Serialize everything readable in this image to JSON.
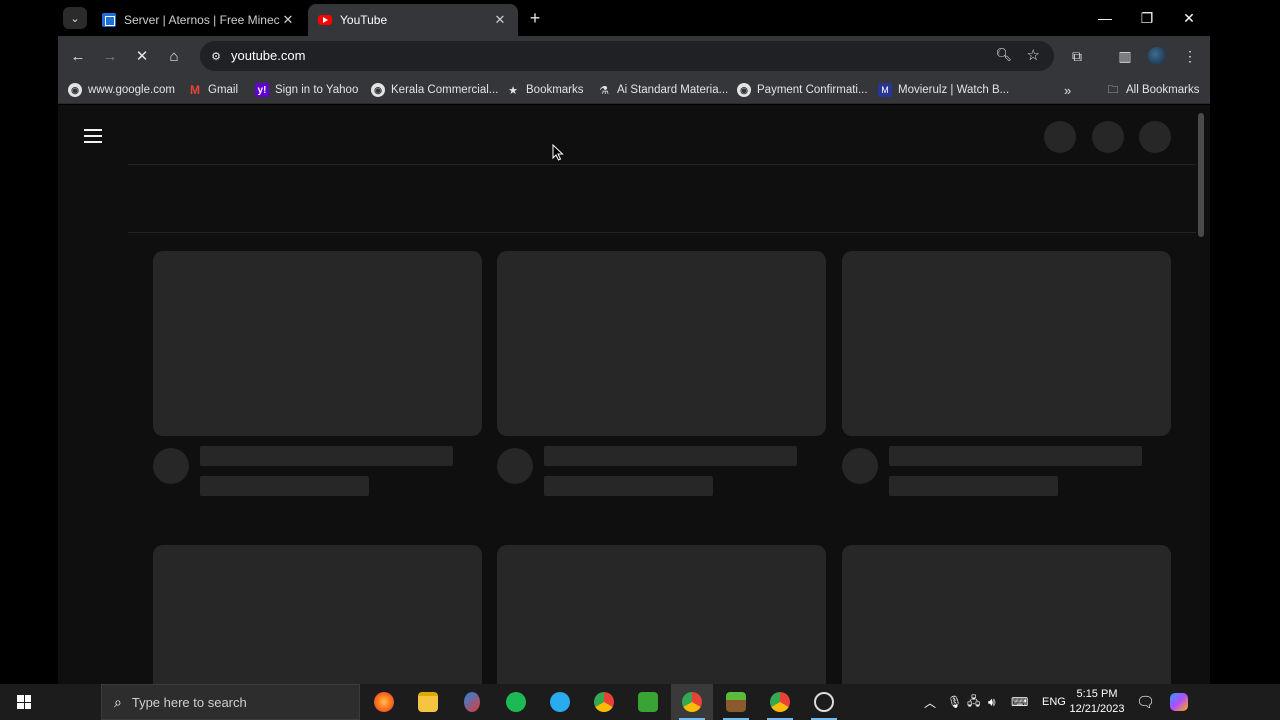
{
  "tabs": [
    {
      "title": "Server | Aternos | Free Minecraft",
      "favicon": "aternos-icon"
    },
    {
      "title": "YouTube",
      "favicon": "youtube-icon"
    }
  ],
  "toolbar": {
    "url": "youtube.com"
  },
  "bookmarks": [
    {
      "label": "www.google.com",
      "icon": "globe-icon"
    },
    {
      "label": "Gmail",
      "icon": "gmail-icon"
    },
    {
      "label": "Sign in to Yahoo",
      "icon": "yahoo-icon"
    },
    {
      "label": "Kerala Commercial...",
      "icon": "globe-icon"
    },
    {
      "label": "Bookmarks",
      "icon": "star-icon"
    },
    {
      "label": "Ai Standard Materia...",
      "icon": "flask-icon"
    },
    {
      "label": "Payment Confirmati...",
      "icon": "globe-icon"
    },
    {
      "label": "Movierulz | Watch B...",
      "icon": "movierulz-icon"
    }
  ],
  "all_bookmarks_label": "All Bookmarks",
  "taskbar": {
    "search_placeholder": "Type here to search",
    "language": "ENG",
    "time": "5:15 PM",
    "date": "12/21/2023",
    "apps": [
      "firefox",
      "file-explorer",
      "snipping-tool",
      "spotify",
      "telegram",
      "chrome",
      "minecraft-launcher",
      "chrome",
      "minecraft",
      "chrome",
      "performance-monitor"
    ]
  },
  "colors": {
    "page_bg": "#0f0f0f",
    "skeleton": "#272727",
    "chrome_toolbar": "#35363a",
    "taskbar": "#1c1c1c"
  }
}
